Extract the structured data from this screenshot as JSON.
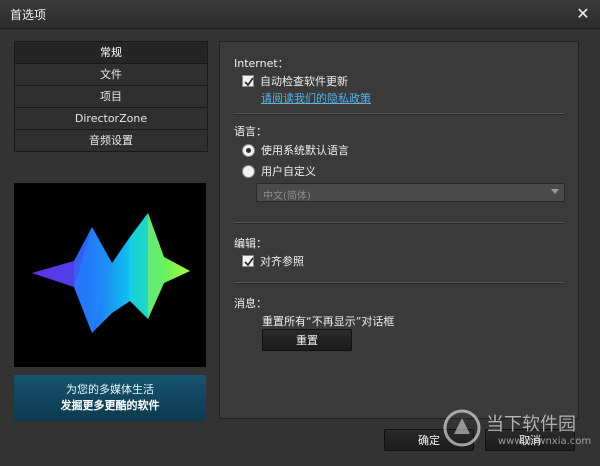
{
  "window": {
    "title": "首选项",
    "close_glyph": "✕"
  },
  "nav": {
    "items": [
      {
        "label": "常规",
        "active": true
      },
      {
        "label": "文件",
        "active": false
      },
      {
        "label": "项目",
        "active": false
      },
      {
        "label": "DirectorZone",
        "active": false
      },
      {
        "label": "音频设置",
        "active": false
      }
    ]
  },
  "promo": {
    "line1": "为您的多媒体生活",
    "line2": "发掘更多更酷的软件"
  },
  "internet": {
    "title": "Internet：",
    "auto_update_label": "自动检查软件更新",
    "auto_update_checked": true,
    "privacy_link": "请阅读我们的隐私政策"
  },
  "language": {
    "title": "语言：",
    "option_system": "使用系统默认语言",
    "option_custom": "用户自定义",
    "selected": "system",
    "select_value": "中文(简体)"
  },
  "edit": {
    "title": "编辑：",
    "snap_label": "对齐参照",
    "snap_checked": true
  },
  "messages": {
    "title": "消息：",
    "reset_desc": "重置所有“不再显示”对话框",
    "reset_button": "重置"
  },
  "footer": {
    "ok_button": "确定",
    "cancel_button": "取消"
  },
  "watermark": {
    "text": "当下软件园",
    "url": "www.downxia.com"
  },
  "colors": {
    "link": "#5ab0e8",
    "promo_bg": "#16536e",
    "panel_bg": "#3a3a3a"
  }
}
